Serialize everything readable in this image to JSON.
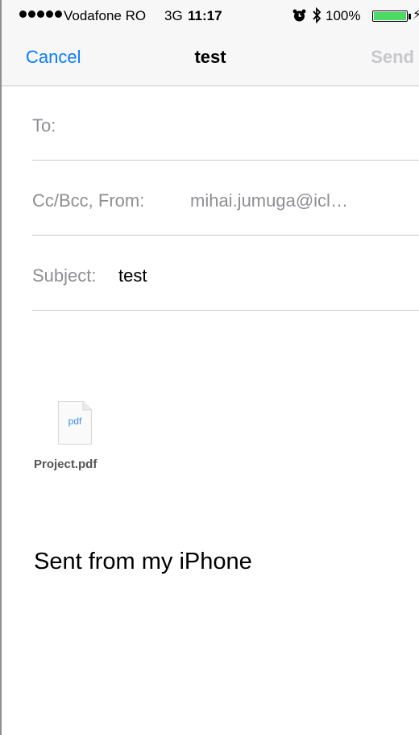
{
  "status_bar": {
    "carrier": "Vodafone RO",
    "network": "3G",
    "time": "11:17",
    "battery_percent": "100%",
    "battery_level": 1.0,
    "battery_color": "#4cd964",
    "icons": [
      "signal-dots-icon",
      "alarm-icon",
      "bluetooth-icon",
      "battery-icon",
      "charging-icon"
    ]
  },
  "nav": {
    "cancel_label": "Cancel",
    "title": "test",
    "send_label": "Send",
    "accent_color": "#0a7aff"
  },
  "fields": {
    "to_label": "To:",
    "to_value": "",
    "cc_label": "Cc/Bcc, From:",
    "cc_value": "mihai.jumuga@icl…",
    "subject_label": "Subject:",
    "subject_value": "test"
  },
  "attachment": {
    "icon_text": "pdf",
    "filename": "Project.pdf"
  },
  "body": {
    "signature": "Sent from my iPhone"
  }
}
